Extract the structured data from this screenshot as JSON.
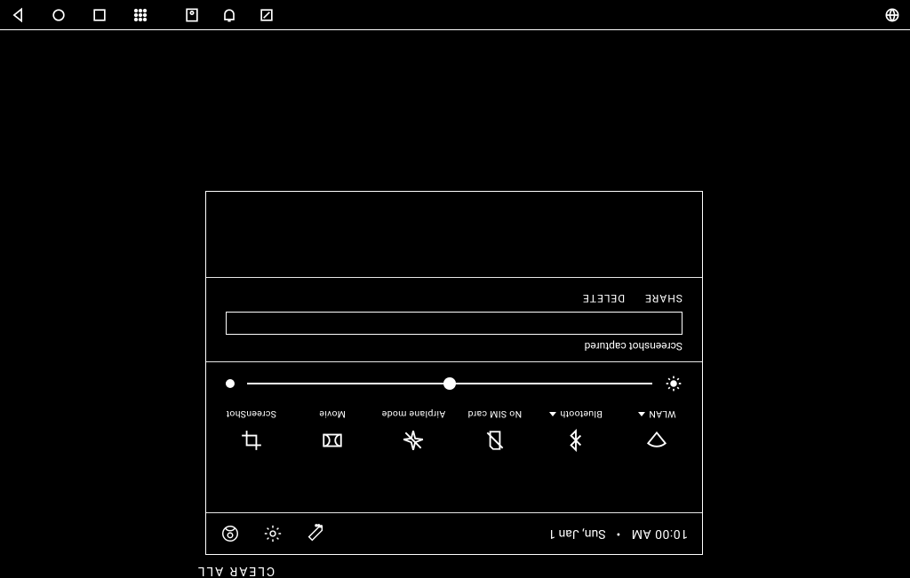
{
  "status": {
    "time": "10:00 AM",
    "date": "Sun, Jan 1"
  },
  "tiles": {
    "wlan": "WLAN",
    "bluetooth": "Bluetooth",
    "sim": "No SIM card",
    "airplane": "Airplane mode",
    "movie": "Movie",
    "screenshot": "ScreenShot"
  },
  "brightness": {
    "percent": 50
  },
  "notification": {
    "title": "Screenshot captured",
    "share": "SHARE",
    "delete": "DELETE"
  },
  "clear_all": "CLEAR ALL"
}
